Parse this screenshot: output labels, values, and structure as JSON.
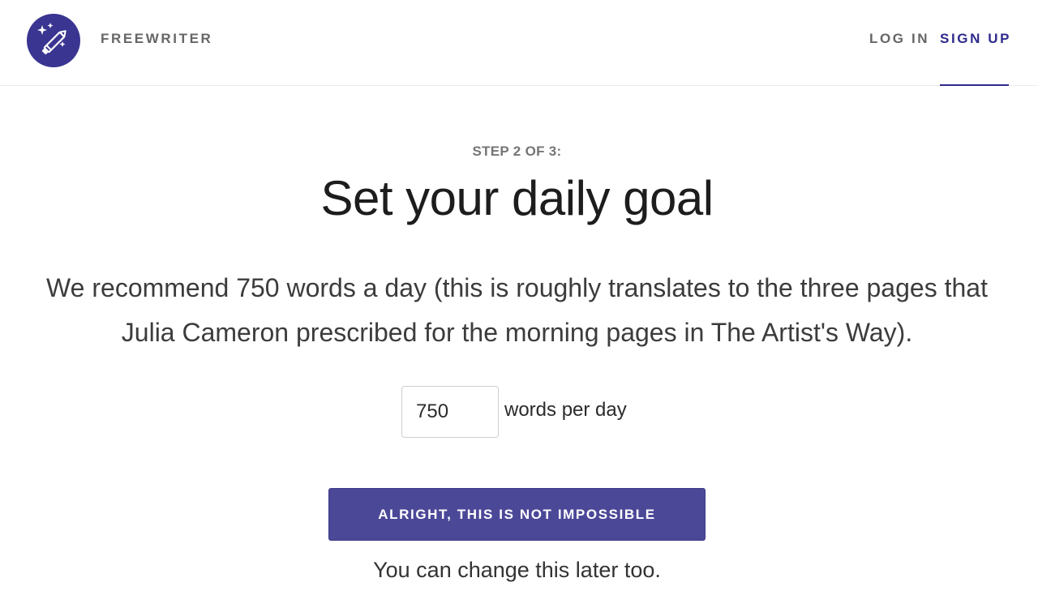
{
  "header": {
    "brand": "FREEWRITER",
    "logo_icon": "magic-pencil-icon",
    "nav": {
      "login": "LOG IN",
      "signup": "SIGN UP",
      "active": "signup"
    }
  },
  "colors": {
    "brand": "#3a3591",
    "accent": "#2f2a8c",
    "button": "#4c4898"
  },
  "main": {
    "step": "STEP 2 OF 3:",
    "title": "Set your daily goal",
    "description": "We recommend 750 words a day (this is roughly translates to the three pages that Julia Cameron prescribed for the morning pages in The Artist's Way).",
    "goal": {
      "value": "750",
      "unit": "words per day"
    },
    "cta_label": "ALRIGHT, THIS IS NOT IMPOSSIBLE",
    "note": "You can change this later too."
  }
}
